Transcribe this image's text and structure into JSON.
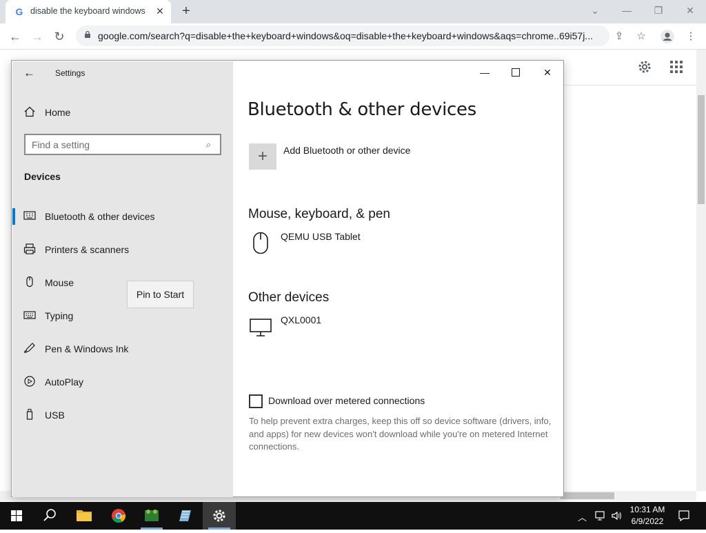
{
  "browser": {
    "tab_title": "disable the keyboard windows -",
    "tab_favicon": "G",
    "url": "google.com/search?q=disable+the+keyboard+windows&oq=disable+the+keyboard+windows&aqs=chrome..69i57j..."
  },
  "settings": {
    "app_title": "Settings",
    "home_label": "Home",
    "search_placeholder": "Find a setting",
    "section_label": "Devices",
    "nav_items": [
      {
        "label": "Bluetooth & other devices",
        "icon": "bluetooth-devices-icon",
        "selected": true
      },
      {
        "label": "Printers & scanners",
        "icon": "printer-icon"
      },
      {
        "label": "Mouse",
        "icon": "mouse-icon"
      },
      {
        "label": "Typing",
        "icon": "keyboard-icon"
      },
      {
        "label": "Pen & Windows Ink",
        "icon": "pen-icon"
      },
      {
        "label": "AutoPlay",
        "icon": "autoplay-icon"
      },
      {
        "label": "USB",
        "icon": "usb-icon"
      }
    ],
    "tooltip": "Pin to Start",
    "page_title": "Bluetooth & other devices",
    "add_device_label": "Add Bluetooth or other device",
    "section_mkp": "Mouse, keyboard, & pen",
    "mkp_device": "QEMU USB Tablet",
    "section_other": "Other devices",
    "other_device": "QXL0001",
    "metered_label": "Download over metered connections",
    "metered_checked": false,
    "metered_help": "To help prevent extra charges, keep this off so device software (drivers, info, and apps) for new devices won't download while you're on metered Internet connections."
  },
  "taskbar": {
    "time": "10:31 AM",
    "date": "6/9/2022"
  },
  "colors": {
    "accent": "#0078d7",
    "sidebar": "#e6e6e6",
    "taskbar": "#101010"
  }
}
